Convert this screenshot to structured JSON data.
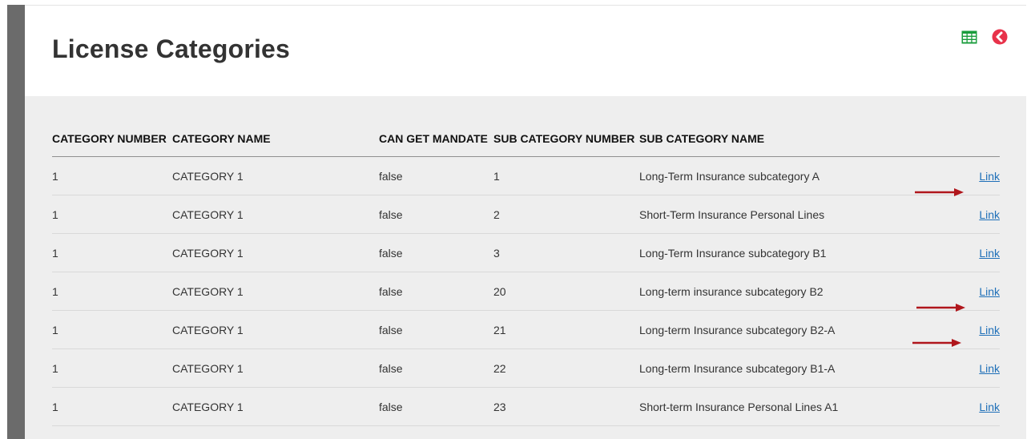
{
  "page": {
    "title": "License Categories"
  },
  "toolbar": {
    "export_icon": "table-grid-icon",
    "back_icon": "circle-chevron-left-icon",
    "export_color": "#1a9c3c",
    "back_color": "#e8324a"
  },
  "table": {
    "headers": [
      "CATEGORY NUMBER",
      "CATEGORY NAME",
      "CAN GET MANDATE",
      "SUB CATEGORY NUMBER",
      "SUB CATEGORY NAME",
      ""
    ],
    "rows": [
      {
        "category_number": "1",
        "category_name": "CATEGORY 1",
        "can_get_mandate": "false",
        "sub_category_number": "1",
        "sub_category_name": "Long-Term Insurance subcategory A",
        "link": "Link"
      },
      {
        "category_number": "1",
        "category_name": "CATEGORY 1",
        "can_get_mandate": "false",
        "sub_category_number": "2",
        "sub_category_name": "Short-Term Insurance Personal Lines",
        "link": "Link"
      },
      {
        "category_number": "1",
        "category_name": "CATEGORY 1",
        "can_get_mandate": "false",
        "sub_category_number": "3",
        "sub_category_name": "Long-Term Insurance subcategory B1",
        "link": "Link"
      },
      {
        "category_number": "1",
        "category_name": "CATEGORY 1",
        "can_get_mandate": "false",
        "sub_category_number": "20",
        "sub_category_name": "Long-term insurance subcategory B2",
        "link": "Link"
      },
      {
        "category_number": "1",
        "category_name": "CATEGORY 1",
        "can_get_mandate": "false",
        "sub_category_number": "21",
        "sub_category_name": "Long-term Insurance subcategory B2-A",
        "link": "Link"
      },
      {
        "category_number": "1",
        "category_name": "CATEGORY 1",
        "can_get_mandate": "false",
        "sub_category_number": "22",
        "sub_category_name": "Long-term Insurance subcategory B1-A",
        "link": "Link"
      },
      {
        "category_number": "1",
        "category_name": "CATEGORY 1",
        "can_get_mandate": "false",
        "sub_category_number": "23",
        "sub_category_name": "Short-term Insurance Personal Lines A1",
        "link": "Link"
      }
    ]
  },
  "annotations": {
    "arrow_color": "#b0161c",
    "arrow_icon": "red-arrow-right-icon"
  },
  "colors": {
    "link": "#1e6fb8",
    "title": "#333333",
    "content_bg": "#eeeeee"
  }
}
